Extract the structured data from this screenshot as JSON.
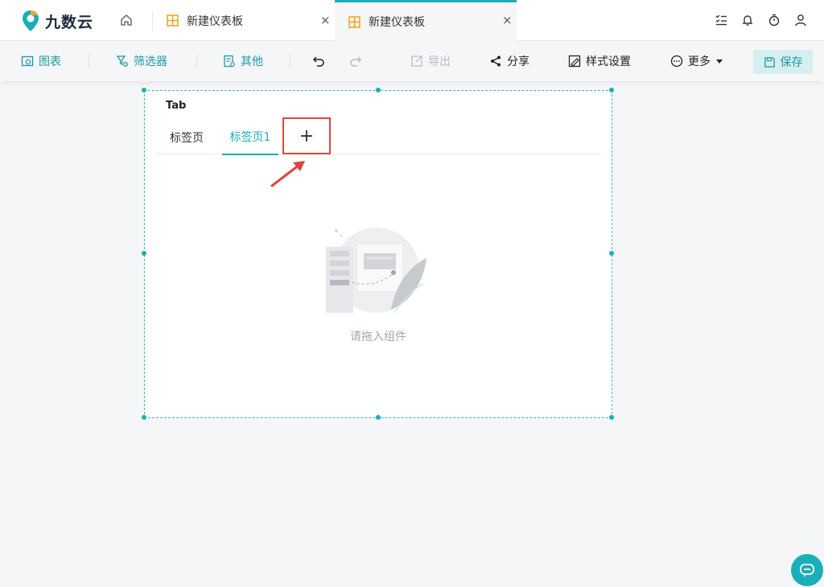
{
  "app": {
    "name": "九数云"
  },
  "tabs": [
    {
      "title": "新建仪表板",
      "close": "×"
    },
    {
      "title": "新建仪表板",
      "close": "×"
    }
  ],
  "toolbar": {
    "chart": "图表",
    "filter": "筛选器",
    "other": "其他",
    "export": "导出",
    "share": "分享",
    "style": "样式设置",
    "more": "更多",
    "save": "保存"
  },
  "component": {
    "title": "Tab",
    "tabs": [
      "标签页",
      "标签页1"
    ],
    "add_symbol": "+",
    "empty_text": "请拖入组件"
  },
  "icons": [
    "logo-icon",
    "home-icon",
    "dashboard-icon",
    "task-list-icon",
    "bell-icon",
    "timer-icon",
    "user-icon",
    "chart-icon",
    "filter-icon",
    "other-icon",
    "undo-icon",
    "redo-icon",
    "export-icon",
    "share-icon",
    "style-icon",
    "more-icon",
    "save-icon",
    "help-icon"
  ],
  "colors": {
    "accent": "#1aaeb8",
    "highlight": "#e0453a",
    "brand_orange": "#f5a623"
  }
}
